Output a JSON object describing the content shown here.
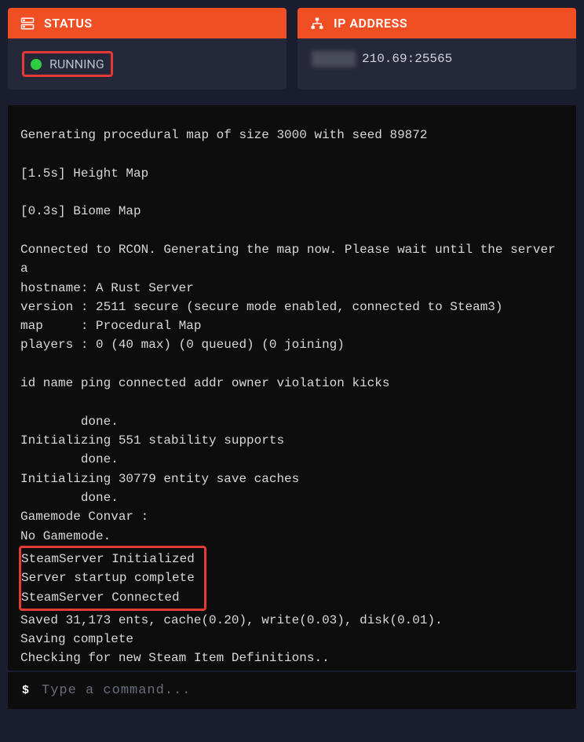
{
  "status_card": {
    "title": "STATUS",
    "value": "RUNNING",
    "indicator_color": "#2ecc40"
  },
  "ip_card": {
    "title": "IP ADDRESS",
    "value_visible": "210.69:25565"
  },
  "console": {
    "lines_before": "Generating procedural map of size 3000 with seed 89872\n\n[1.5s] Height Map\n\n[0.3s] Biome Map\n\nConnected to RCON. Generating the map now. Please wait until the server a\nhostname: A Rust Server\nversion : 2511 secure (secure mode enabled, connected to Steam3)\nmap     : Procedural Map\nplayers : 0 (40 max) (0 queued) (0 joining)\n\nid name ping connected addr owner violation kicks\n\n        done.\nInitializing 551 stability supports\n        done.\nInitializing 30779 entity save caches\n        done.\nGamemode Convar :\nNo Gamemode.",
    "lines_highlighted": "SteamServer Initialized\nServer startup complete\nSteamServer Connected",
    "lines_after": "Saved 31,173 ents, cache(0.20), write(0.03), disk(0.01).\nSaving complete\nChecking for new Steam Item Definitions..",
    "prompt": "$",
    "input_placeholder": "Type a command..."
  }
}
